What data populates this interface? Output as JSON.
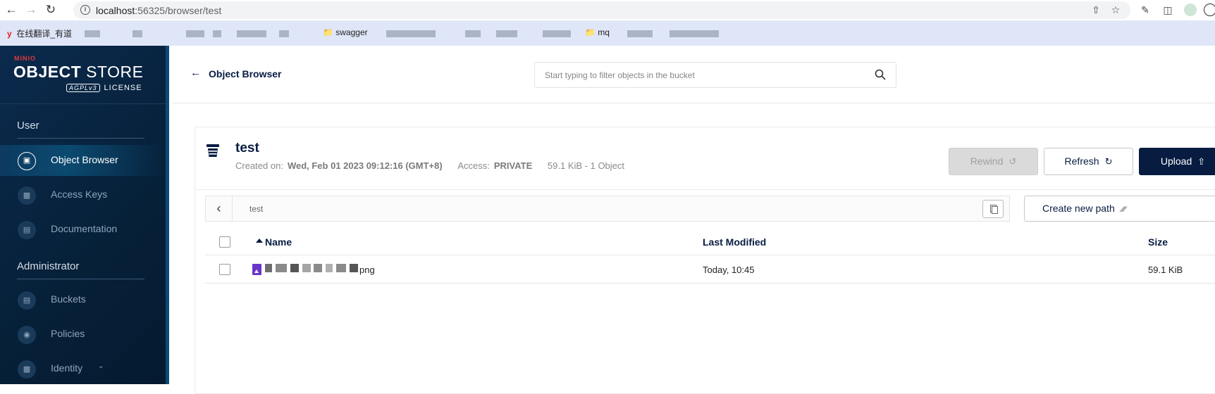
{
  "browser": {
    "url_host": "localhost",
    "url_rest": ":56325/browser/test",
    "bookmarks": [
      {
        "label": "在线翻译_有道",
        "icon": "youdao-icon"
      },
      {
        "label": "swagger",
        "icon": "folder-icon"
      },
      {
        "label": "mq",
        "icon": "folder-icon"
      }
    ]
  },
  "sidebar": {
    "logo_small": "MINIO",
    "logo_main_bold": "OBJECT",
    "logo_main_thin": " STORE",
    "logo_agpl": "AGPLv3",
    "logo_license": "LICENSE",
    "sections": [
      {
        "title": "User",
        "items": [
          {
            "label": "Object Browser",
            "icon": "object-browser-icon",
            "active": true
          },
          {
            "label": "Access Keys",
            "icon": "access-keys-icon"
          },
          {
            "label": "Documentation",
            "icon": "documentation-icon"
          }
        ]
      },
      {
        "title": "Administrator",
        "items": [
          {
            "label": "Buckets",
            "icon": "buckets-icon"
          },
          {
            "label": "Policies",
            "icon": "policies-icon"
          },
          {
            "label": "Identity",
            "icon": "identity-icon",
            "expandable": true
          }
        ]
      }
    ]
  },
  "header": {
    "back_label": "Object Browser",
    "search_placeholder": "Start typing to filter objects in the bucket"
  },
  "bucket": {
    "name": "test",
    "created_label": "Created on:",
    "created_value": "Wed, Feb 01 2023 09:12:16 (GMT+8)",
    "access_label": "Access:",
    "access_value": "PRIVATE",
    "summary": "59.1 KiB - 1 Object",
    "buttons": {
      "rewind": "Rewind",
      "refresh": "Refresh",
      "upload": "Upload"
    }
  },
  "path_bar": {
    "path": "test",
    "create_new_path": "Create new path"
  },
  "table": {
    "columns": {
      "name": "Name",
      "last_modified": "Last Modified",
      "size": "Size"
    },
    "rows": [
      {
        "name_suffix": "png",
        "last_modified": "Today, 10:45",
        "size": "59.1 KiB"
      }
    ]
  },
  "colors": {
    "sidebar_bg": "#062038",
    "primary_navy": "#081c42",
    "minio_red": "#e03a3e",
    "file_icon_purple": "#6a35c9"
  }
}
